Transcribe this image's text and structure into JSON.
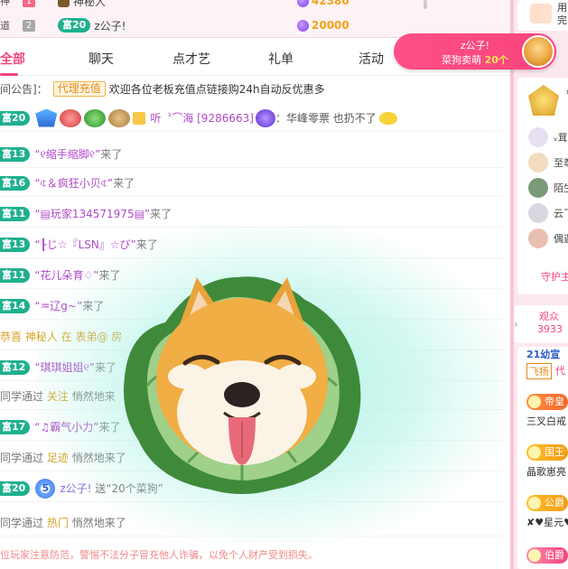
{
  "rank_strip": {
    "edge_top": "神",
    "edge_bottom": "道",
    "row1": {
      "rank": "1",
      "name": "神秘人",
      "coins": "42380"
    },
    "row2": {
      "rank": "2",
      "level": "富20",
      "name": "z公子!",
      "coins": "20000"
    }
  },
  "gift_notice": {
    "user": "z公子!",
    "gift": "菜狗卖萌",
    "count": "20个"
  },
  "tabs": [
    {
      "label": "全部",
      "active": true
    },
    {
      "label": "聊天",
      "active": false
    },
    {
      "label": "点才艺",
      "active": false
    },
    {
      "label": "礼单",
      "active": false
    },
    {
      "label": "活动",
      "active": false
    }
  ],
  "announcement": {
    "label": "间公告]：",
    "badge": "代理充值",
    "text": "欢迎各位老板充值点链接购24h自动反优惠多"
  },
  "chat": [
    {
      "level": "富20",
      "user": "听〝⌒海 [9286663]",
      "text": "：华峰零票 也扔不了"
    },
    {
      "level": "富13",
      "user": "“୧缩手缩脚୧”",
      "text": "来了"
    },
    {
      "level": "富16",
      "user": "“⍧＆疯狂小贝⍧”",
      "text": "来了"
    },
    {
      "level": "富11",
      "user": "“▤玩家134571975▤”",
      "text": "来了"
    },
    {
      "level": "富13",
      "user": "“┠じ☆『LSN』☆び”",
      "text": "来了"
    },
    {
      "level": "富11",
      "user": "“花儿朵育♢”",
      "text": "来了"
    },
    {
      "level": "富14",
      "user": "“♒辽g~”",
      "text": "来了"
    },
    {
      "system": true,
      "text": "恭喜 神秘人 在 表弟@ 房"
    },
    {
      "level": "富12",
      "user": "“琪琪姐姐୧”",
      "text": "来了"
    },
    {
      "system": true,
      "prefix": "同学通过",
      "link": "关注",
      "suffix": "悄然地来"
    },
    {
      "level": "富17",
      "user": "“♫霸气小力”",
      "text": "来了"
    },
    {
      "system": true,
      "prefix": "同学通过",
      "link": "足迹",
      "suffix": "悄然地来了"
    },
    {
      "level": "富20",
      "badge": "5",
      "user": "z公子!",
      "text": "送“20个菜狗”"
    },
    {
      "system": true,
      "prefix": "同学通过",
      "link": "热门",
      "suffix": "悄然地来了"
    }
  ],
  "footer_note": "位玩家注意防范，警惕不法分子冒充他人诈骗，以免个人财产受到损失。",
  "right_panel": {
    "top_line1": "用",
    "top_line2": "完",
    "guard_side": "守",
    "guard_users": [
      "ᵥ茸",
      "至尊",
      "陌生",
      "云飞",
      "偶遇"
    ],
    "protect_label": "守护主",
    "audience_label": "观众",
    "audience_count": "3933",
    "list_level": "21幼宣",
    "list_tag": "飞扬",
    "list_sub": "代",
    "emperor_tag": "帝皇",
    "emperor_name": "三叉白戒",
    "king_tag": "国王",
    "king_name": "晶歌崽亮",
    "duke_tag": "公爵",
    "duke_name": "✘♥星元♥",
    "earl_tag": "伯爵"
  }
}
